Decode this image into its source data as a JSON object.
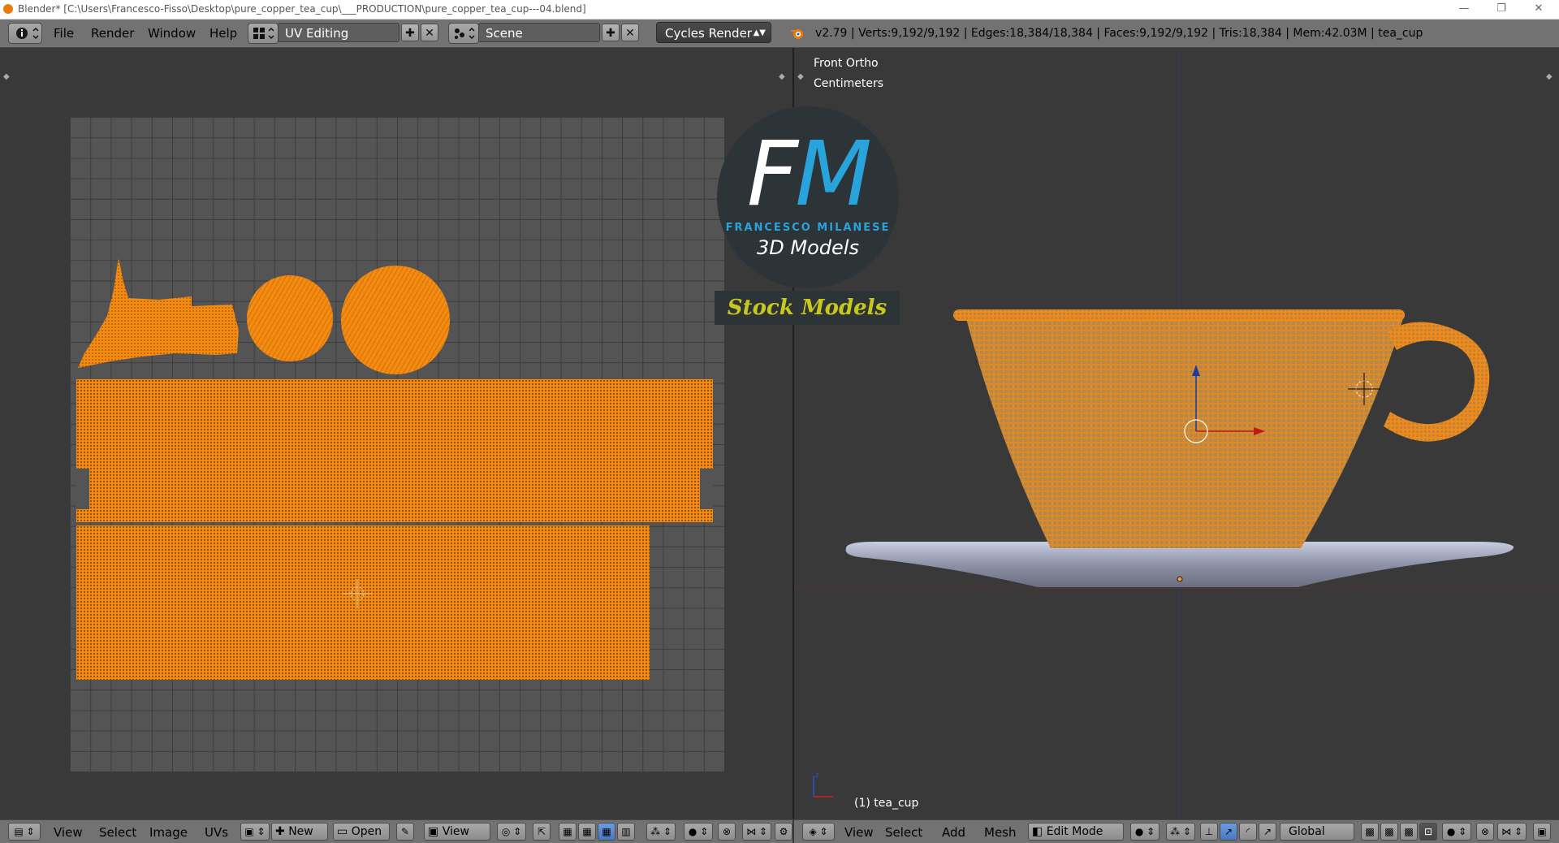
{
  "titlebar": {
    "title": "Blender* [C:\\Users\\Francesco-Fisso\\Desktop\\pure_copper_tea_cup\\___PRODUCTION\\pure_copper_tea_cup---04.blend]",
    "minimize": "—",
    "restore": "❐",
    "close": "✕"
  },
  "topbar": {
    "menus": [
      "File",
      "Render",
      "Window",
      "Help"
    ],
    "layout": "UV Editing",
    "scene": "Scene",
    "render_engine": "Cycles Render",
    "stats": "v2.79 | Verts:9,192/9,192 | Edges:18,384/18,384 | Faces:9,192/9,192 | Tris:18,384 | Mem:42.03M | tea_cup"
  },
  "viewport": {
    "view_name": "Front Ortho",
    "units": "Centimeters",
    "object_label": "(1) tea_cup"
  },
  "logo": {
    "f": "F",
    "m": "M",
    "author": "FRANCESCO MILANESE",
    "subtitle": "3D Models",
    "badge": "Stock Models"
  },
  "uv_header": {
    "menus": [
      "View",
      "Select",
      "Image",
      "UVs"
    ],
    "new_label": "New",
    "open_label": "Open",
    "view_label": "View"
  },
  "view3d_header": {
    "menus": [
      "View",
      "Select",
      "Add",
      "Mesh"
    ],
    "mode": "Edit Mode",
    "orientation": "Global"
  },
  "colors": {
    "uv_orange": "#f58a0f",
    "background": "#393939",
    "header": "#727272",
    "logo_blue": "#29a3dc"
  }
}
